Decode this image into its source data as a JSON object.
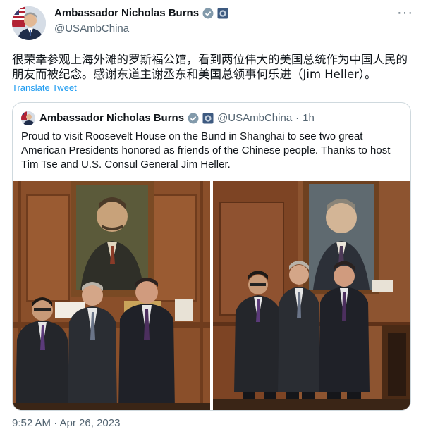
{
  "tweet": {
    "author_name": "Ambassador Nicholas Burns",
    "handle": "@USAmbChina",
    "text": "很荣幸参观上海外滩的罗斯福公馆，看到两位伟大的美国总统作为中国人民的朋友而被纪念。感谢东道主谢丞东和美国总领事何乐进（Jim Heller）。",
    "translate_label": "Translate Tweet",
    "more_label": "···",
    "timestamp": "9:52 AM · Apr 26, 2023"
  },
  "quoted": {
    "author_name": "Ambassador Nicholas Burns",
    "handle": "@USAmbChina",
    "separator": "·",
    "time": "1h",
    "text": "Proud to visit Roosevelt House on the Bund in Shanghai to see two great American Presidents honored as friends of the Chinese people.  Thanks to host Tim Tse and U.S. Consul General Jim Heller."
  },
  "icons": [
    "verified-badge-icon",
    "government-label-icon",
    "more-options-icon"
  ],
  "colors": {
    "link": "#1d9bf0",
    "secondary": "#536471",
    "border": "#cfd9de",
    "wood": "#8a4f2a"
  }
}
